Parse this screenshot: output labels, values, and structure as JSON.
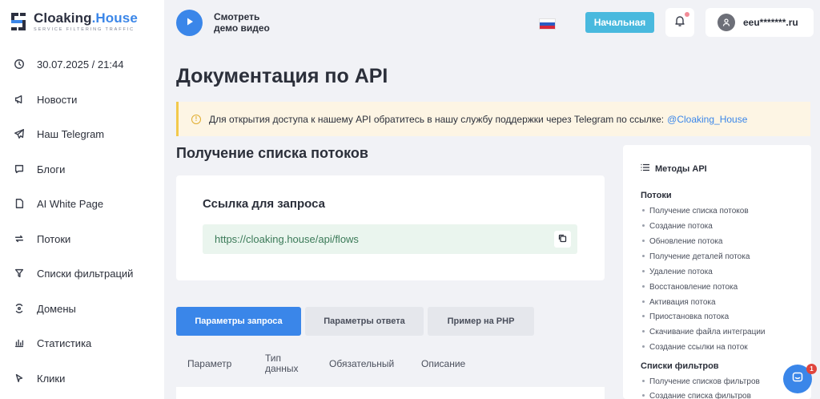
{
  "brand": {
    "name_main": "Cloaking",
    "name_accent": ".House",
    "tagline": "Service filtering traffic"
  },
  "sidebar": {
    "items": [
      {
        "label": "30.07.2025 / 21:44",
        "icon": "clock-icon"
      },
      {
        "label": "Новости",
        "icon": "megaphone-icon"
      },
      {
        "label": "Наш Telegram",
        "icon": "telegram-icon"
      },
      {
        "label": "Блоги",
        "icon": "chat-bubble-icon"
      },
      {
        "label": "AI White Page",
        "icon": "document-icon"
      },
      {
        "label": "Потоки",
        "icon": "flow-arrows-icon"
      },
      {
        "label": "Списки фильтраций",
        "icon": "filter-icon"
      },
      {
        "label": "Домены",
        "icon": "domain-icon"
      },
      {
        "label": "Статистика",
        "icon": "bar-chart-icon"
      },
      {
        "label": "Клики",
        "icon": "cursor-icon"
      }
    ]
  },
  "header": {
    "demo_line1": "Смотреть",
    "demo_line2": "демо видео",
    "home_button": "Начальная",
    "user_name": "eeu*******.ru",
    "language_flag": "ru-flag"
  },
  "main": {
    "title": "Документация по API",
    "notice_text": "Для открытия доступа к нашему API обратитесь в нашу службу поддержки через Telegram по ссылке:",
    "notice_link": "@Cloaking_House",
    "section_title": "Получение списка потоков",
    "request_card_title": "Ссылка для запроса",
    "request_url": "https://cloaking.house/api/flows",
    "tabs": [
      {
        "label": "Параметры запроса"
      },
      {
        "label": "Параметры ответа"
      },
      {
        "label": "Пример на PHP"
      }
    ],
    "table_headers": {
      "param": "Параметр",
      "type_line1": "Тип",
      "type_line2": "данных",
      "required": "Обязательный",
      "description": "Описание"
    }
  },
  "methods": {
    "title": "Методы API",
    "groups": [
      {
        "title": "Потоки",
        "items": [
          "Получение списка потоков",
          "Создание потока",
          "Обновление потока",
          "Получение деталей потока",
          "Удаление потока",
          "Восстановление потока",
          "Активация потока",
          "Приостановка потока",
          "Скачивание файла интеграции",
          "Создание ссылки на поток"
        ]
      },
      {
        "title": "Списки фильтров",
        "items": [
          "Получение списков фильтров",
          "Создание списка фильтров"
        ]
      }
    ]
  },
  "chat": {
    "badge": "1"
  },
  "colors": {
    "accent": "#3a86e9",
    "home_button": "#49b9de",
    "notice_bg": "#fdf5e4",
    "url_bg": "#eaf5ee"
  }
}
